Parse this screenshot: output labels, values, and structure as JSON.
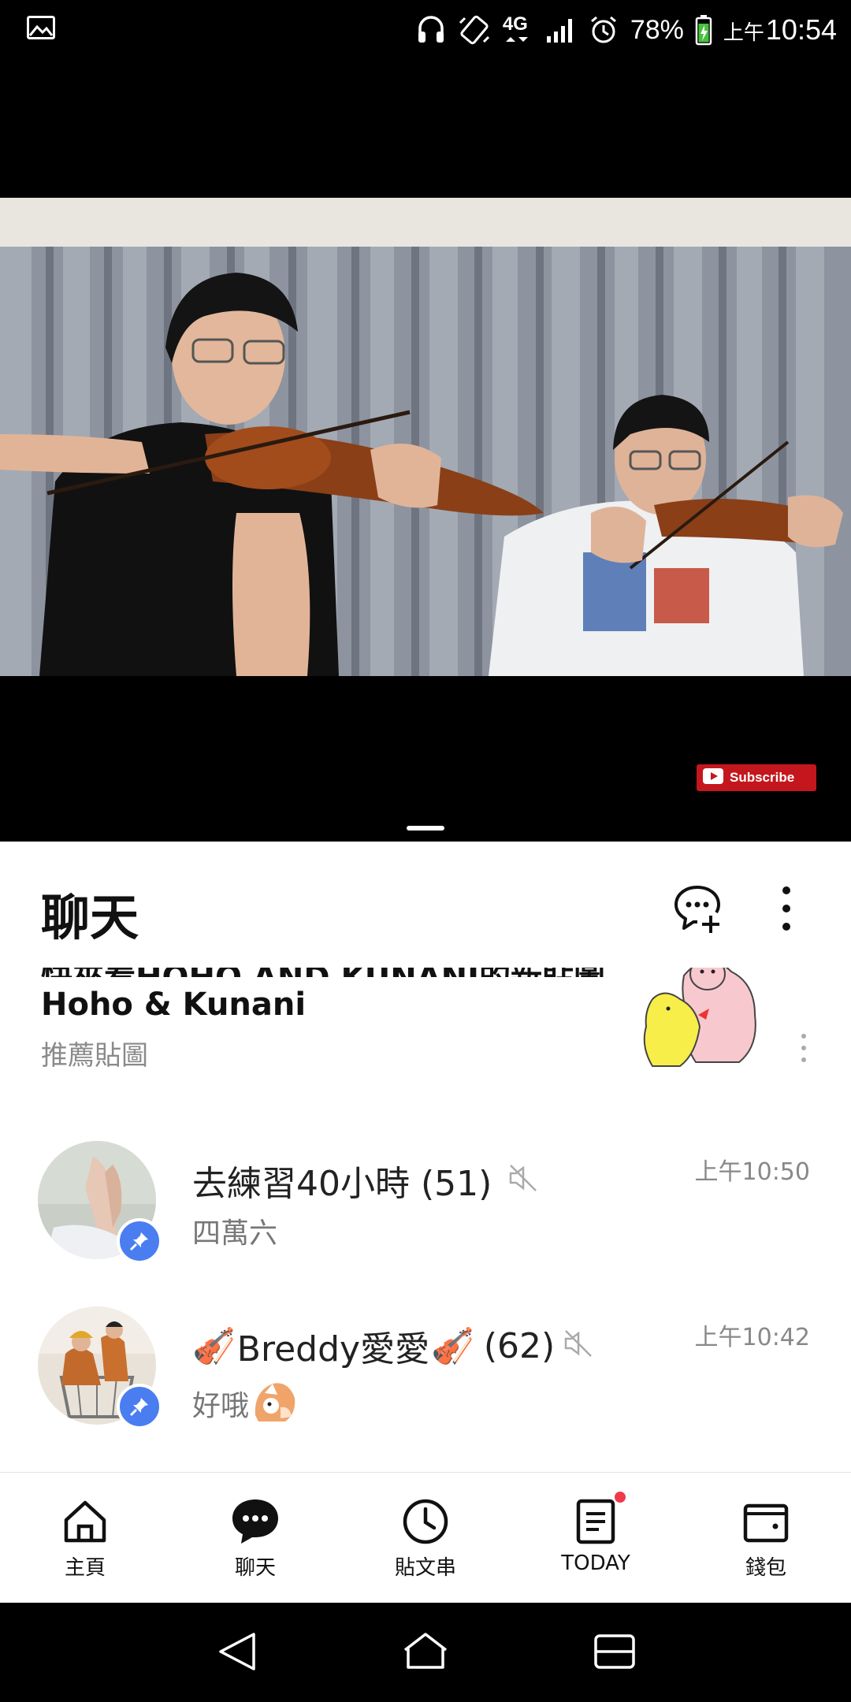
{
  "status_bar": {
    "battery": "78%",
    "ampm": "上午",
    "time": "10:54",
    "network": "4G"
  },
  "video": {
    "subscribe_label": "Subscribe"
  },
  "chat": {
    "title": "聊天",
    "promo": {
      "title": "快來看HOHO AND KUNANI的新貼圖",
      "subtitle": "Hoho & Kunani",
      "tag": "推薦貼圖"
    },
    "items": [
      {
        "name": "去練習40小時 (51)",
        "preview": "四萬六",
        "time": "上午10:50",
        "muted": true,
        "pinned": true
      },
      {
        "name_prefix": "🎻",
        "name_main": "Breddy愛愛",
        "name_suffix": "🎻",
        "name_count": "(62)",
        "preview": "好哦",
        "time": "上午10:42",
        "muted": true,
        "pinned": true
      }
    ]
  },
  "bottom_nav": {
    "items": [
      {
        "label": "主頁",
        "icon": "home-icon"
      },
      {
        "label": "聊天",
        "icon": "chat-icon"
      },
      {
        "label": "貼文串",
        "icon": "clock-icon"
      },
      {
        "label": "TODAY",
        "icon": "news-icon"
      },
      {
        "label": "錢包",
        "icon": "wallet-icon"
      }
    ]
  },
  "colors": {
    "accent_blue": "#4a7df0",
    "badge_red": "#ef3a4b",
    "subscribe_red": "#c4171d"
  }
}
